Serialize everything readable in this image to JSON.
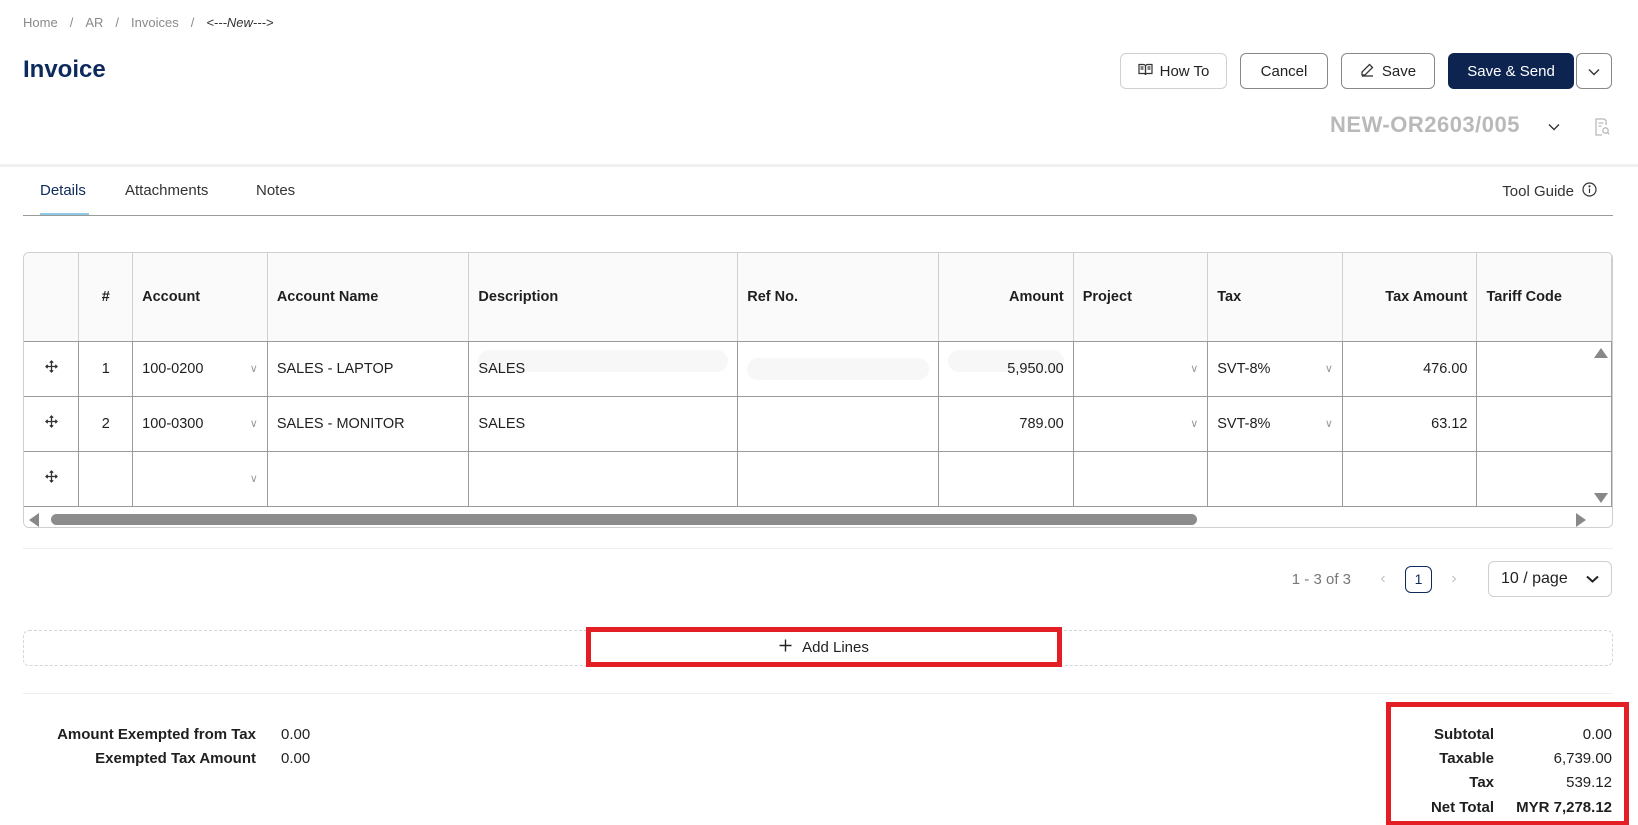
{
  "breadcrumb": {
    "items": [
      "Home",
      "AR",
      "Invoices"
    ],
    "current": "<---New--->"
  },
  "page_title": "Invoice",
  "toolbar": {
    "how_to": "How To",
    "cancel": "Cancel",
    "save": "Save",
    "save_send": "Save & Send"
  },
  "document_number": "NEW-OR2603/005",
  "tabs": {
    "details": "Details",
    "attachments": "Attachments",
    "notes": "Notes",
    "tool_guide": "Tool Guide"
  },
  "grid": {
    "headers": {
      "num": "#",
      "account": "Account",
      "account_name": "Account Name",
      "description": "Description",
      "ref_no": "Ref No.",
      "amount": "Amount",
      "project": "Project",
      "tax": "Tax",
      "tax_amount": "Tax Amount",
      "tariff_code": "Tariff Code"
    },
    "rows": [
      {
        "num": "1",
        "account": "100-0200",
        "account_name": "SALES - LAPTOP",
        "description": "SALES",
        "ref_no": "",
        "amount": "5,950.00",
        "project": "",
        "tax": "SVT-8%",
        "tax_amount": "476.00",
        "tariff_code": ""
      },
      {
        "num": "2",
        "account": "100-0300",
        "account_name": "SALES - MONITOR",
        "description": "SALES",
        "ref_no": "",
        "amount": "789.00",
        "project": "",
        "tax": "SVT-8%",
        "tax_amount": "63.12",
        "tariff_code": ""
      },
      {
        "num": "",
        "account": "",
        "account_name": "",
        "description": "",
        "ref_no": "",
        "amount": "",
        "project": "",
        "tax": "",
        "tax_amount": "",
        "tariff_code": ""
      }
    ]
  },
  "pagination": {
    "range": "1 - 3 of 3",
    "current_page": "1",
    "page_size": "10 / page"
  },
  "add_lines": "Add Lines",
  "exempt": {
    "amount_label": "Amount Exempted from Tax",
    "amount_value": "0.00",
    "tax_label": "Exempted Tax Amount",
    "tax_value": "0.00"
  },
  "totals": {
    "subtotal_label": "Subtotal",
    "subtotal": "0.00",
    "taxable_label": "Taxable",
    "taxable": "6,739.00",
    "tax_label": "Tax",
    "tax": "539.12",
    "net_total_label": "Net Total",
    "net_total": "MYR 7,278.12"
  },
  "colors": {
    "brand": "#0d2451",
    "highlight": "#e31e24",
    "tab_underline": "#8ecae6"
  }
}
